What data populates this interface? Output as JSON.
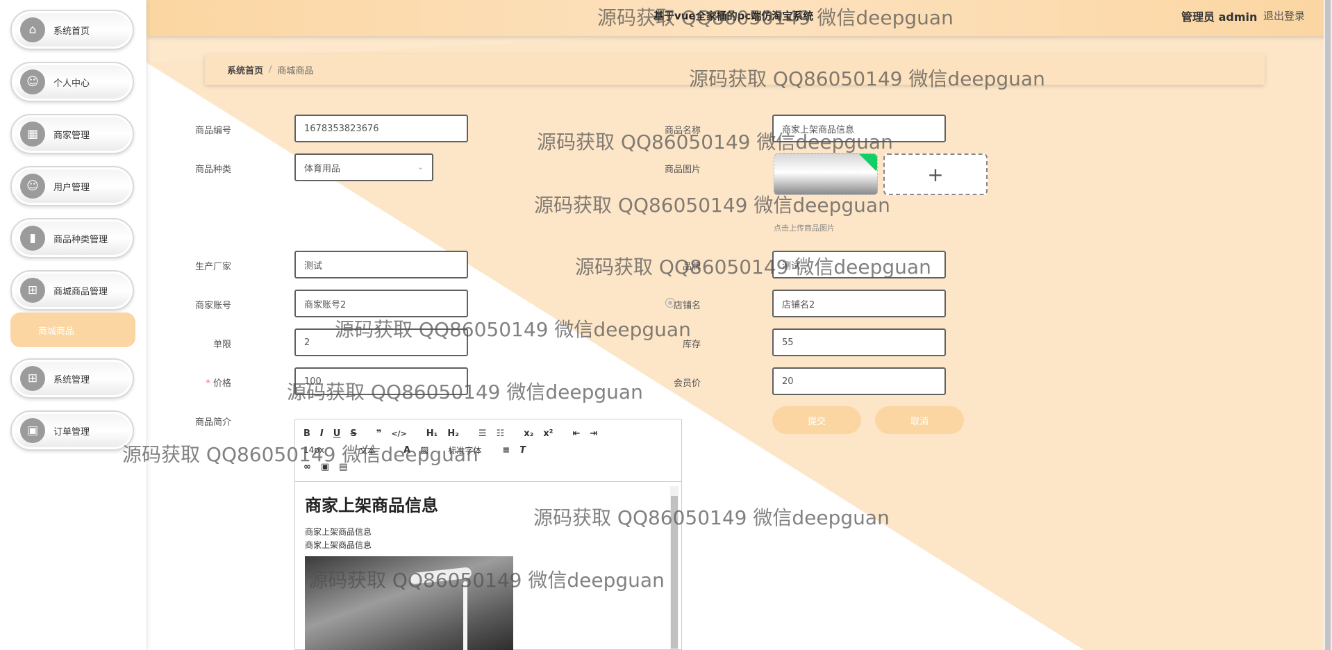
{
  "app": {
    "title": "基于vue全家桶的pc端仿淘宝系统",
    "user_label": "管理员 admin",
    "logout_label": "退出登录"
  },
  "sidebar": {
    "items": [
      {
        "label": "系统首页",
        "icon": "home-icon"
      },
      {
        "label": "个人中心",
        "icon": "user-icon"
      },
      {
        "label": "商家管理",
        "icon": "grid-icon"
      },
      {
        "label": "用户管理",
        "icon": "user-icon"
      },
      {
        "label": "商品种类管理",
        "icon": "book-icon"
      },
      {
        "label": "商城商品管理",
        "icon": "apps-icon"
      },
      {
        "label": "系统管理",
        "icon": "apps-icon"
      },
      {
        "label": "订单管理",
        "icon": "briefcase-icon"
      }
    ],
    "active_sub": "商城商品"
  },
  "breadcrumb": {
    "home": "系统首页",
    "separator": "/",
    "current": "商城商品"
  },
  "form": {
    "product_no": {
      "label": "商品编号",
      "value": "1678353823676"
    },
    "product_name": {
      "label": "商品名称",
      "value": "商家上架商品信息"
    },
    "category": {
      "label": "商品种类",
      "value": "体育用品"
    },
    "image": {
      "label": "商品图片",
      "tip": "点击上传商品图片",
      "add": "+"
    },
    "manufacturer": {
      "label": "生产厂家",
      "value": "测试"
    },
    "brand": {
      "label": "品牌",
      "value": "测试"
    },
    "merchant_account": {
      "label": "商家账号",
      "value": "商家账号2"
    },
    "shop_name": {
      "label": "店铺名",
      "value": "店铺名2"
    },
    "limit": {
      "label": "单限",
      "value": "2"
    },
    "stock": {
      "label": "库存",
      "value": "55"
    },
    "price": {
      "label": "价格",
      "required": "*",
      "value": "100"
    },
    "member_price": {
      "label": "会员价",
      "value": "20"
    },
    "intro": {
      "label": "商品简介"
    },
    "submit": "提交",
    "cancel": "取消"
  },
  "editor": {
    "toolbar_row1": [
      "B",
      "I",
      "U",
      "S",
      "❞",
      "</>",
      "H₁",
      "H₂",
      "☰",
      "☷",
      "x₂",
      "x²",
      "⇤",
      "⇥"
    ],
    "size_select": "14px",
    "font_select": "标准字体",
    "heading_select": "文本",
    "heading": "商家上架商品信息",
    "lines": [
      "商家上架商品信息",
      "商家上架商品信息"
    ]
  },
  "watermark": "源码获取 QQ86050149 微信deepguan",
  "colors": {
    "accent": "#fbd6a2",
    "accent_light": "#fde2bf",
    "success": "#13ce66"
  }
}
